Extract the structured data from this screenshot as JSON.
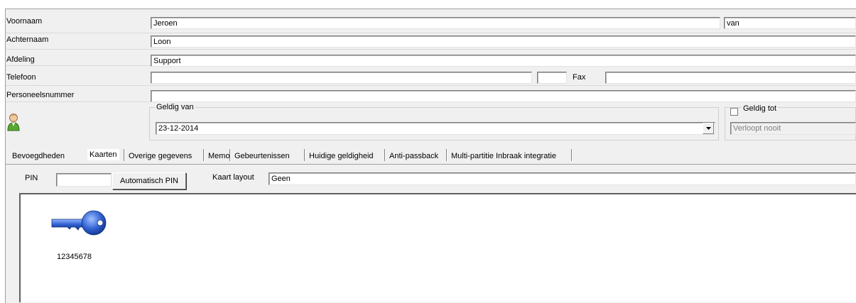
{
  "fields": {
    "voornaam_label": "Voornaam",
    "voornaam_value": "Jeroen",
    "tussenvoegsel_value": "van",
    "achternaam_label": "Achternaam",
    "achternaam_value": "Loon",
    "afdeling_label": "Afdeling",
    "afdeling_value": "Support",
    "telefoon_label": "Telefoon",
    "telefoon_value": "",
    "toestel_value": "",
    "fax_label": "Fax",
    "fax_value": "",
    "personeelsnummer_label": "Personeelsnummer",
    "personeelsnummer_value": ""
  },
  "validity": {
    "from_label": "Geldig van",
    "from_value": "23-12-2014",
    "to_label": "Geldig tot",
    "to_checked": false,
    "to_value": "Verloopt nooit"
  },
  "tabs": [
    {
      "label": "Bevoegdheden"
    },
    {
      "label": "Kaarten",
      "active": true
    },
    {
      "label": "Overige gegevens"
    },
    {
      "label": "Memo"
    },
    {
      "label": "Gebeurtenissen"
    },
    {
      "label": "Huidige geldigheid"
    },
    {
      "label": "Anti-passback"
    },
    {
      "label": "Multi-partitie Inbraak integratie"
    }
  ],
  "kaarten": {
    "pin_label": "PIN",
    "pin_value": "",
    "auto_pin_label": "Automatisch PIN",
    "layout_label": "Kaart layout",
    "layout_value": "Geen",
    "cards": [
      {
        "number": "12345678",
        "icon": "key-icon"
      }
    ]
  },
  "colors": {
    "key_blue": "#2f5fd0",
    "avatar_green": "#5aa832"
  }
}
